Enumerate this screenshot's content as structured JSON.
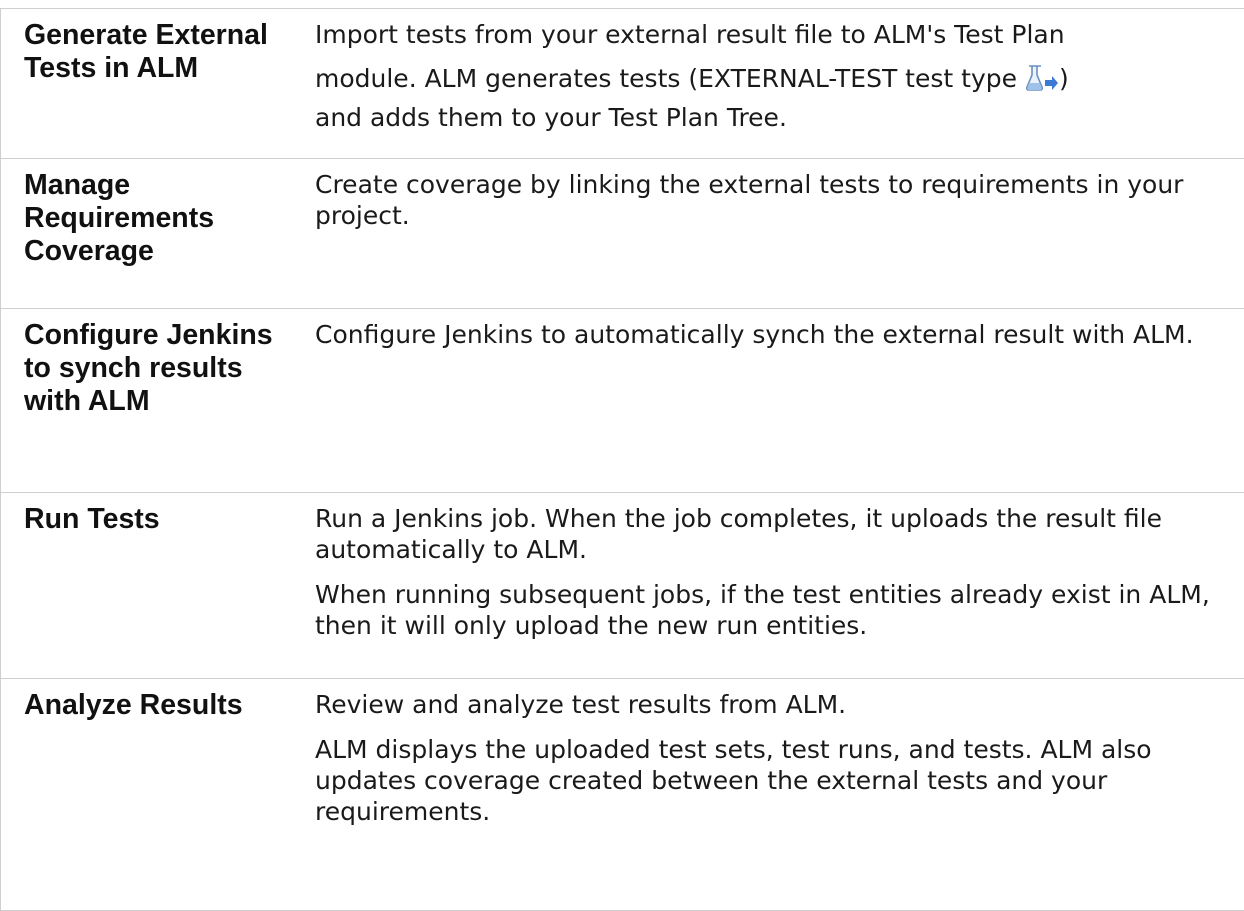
{
  "rows": [
    {
      "step": "Generate External Tests in ALM",
      "paragraphs": [
        "Import tests from your external result file to ALM's Test Plan module. ALM generates tests (EXTERNAL-TEST test type ) and adds them to your Test Plan Tree."
      ],
      "desc_parts": {
        "line1": "Import tests from your external result file to ALM's Test Plan",
        "line2_before_icon": "module. ALM generates tests (EXTERNAL-TEST test type",
        "line2_after_icon": ")",
        "line3": "and adds them to your Test Plan Tree."
      },
      "icon": "external-test-flask-icon"
    },
    {
      "step": "Manage Requirements Coverage",
      "paragraphs": [
        "Create coverage by linking the external tests to requirements in your project."
      ]
    },
    {
      "step": "Configure Jenkins to synch results with ALM",
      "paragraphs": [
        "Configure Jenkins to automatically synch the external result with ALM."
      ]
    },
    {
      "step": "Run Tests",
      "paragraphs": [
        "Run a Jenkins job. When the job completes, it uploads the result file automatically to ALM.",
        "When running subsequent jobs, if the test entities already exist in ALM, then it will only upload the new run entities."
      ]
    },
    {
      "step": "Analyze Results",
      "paragraphs": [
        "Review and analyze test results from ALM.",
        "ALM displays the uploaded test sets, test runs, and tests. ALM also updates coverage created between the external tests and your requirements."
      ]
    }
  ],
  "colors": {
    "border": "#cfcfcf",
    "text": "#1a1a1a",
    "icon_blue": "#3b7bd4"
  }
}
